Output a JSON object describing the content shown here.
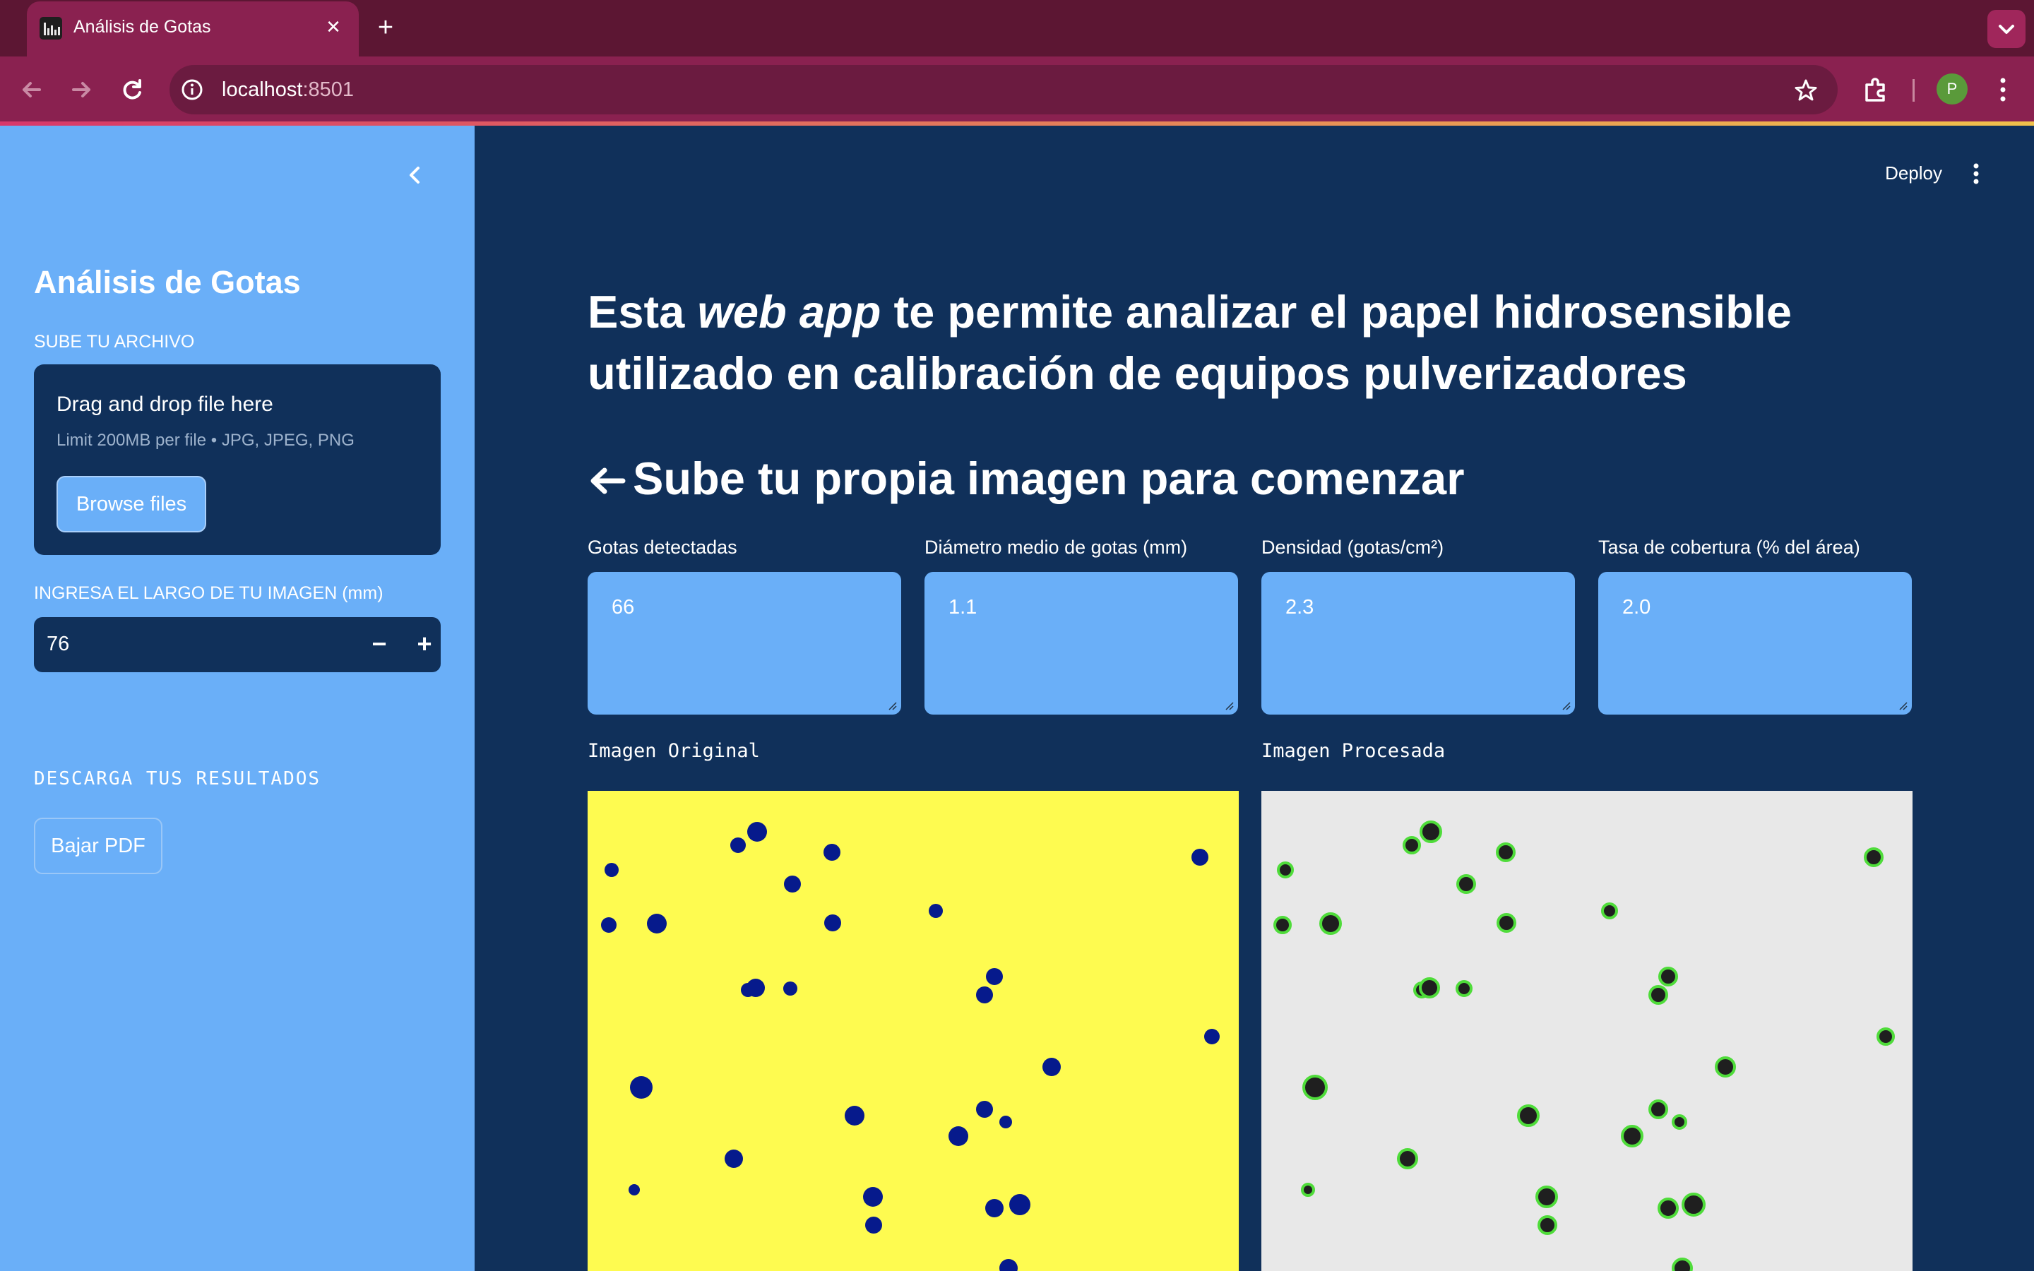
{
  "browser": {
    "tab_title": "Análisis de Gotas",
    "url_host": "localhost",
    "url_port": ":8501",
    "profile_initial": "P"
  },
  "sidebar": {
    "title": "Análisis de Gotas",
    "upload_label": "SUBE TU ARCHIVO",
    "dropzone_title": "Drag and drop file here",
    "dropzone_limit": "Limit 200MB per file • JPG, JPEG, PNG",
    "browse_button": "Browse files",
    "length_label": "INGRESA EL LARGO DE TU IMAGEN (mm)",
    "length_value": "76",
    "minus": "−",
    "plus": "+",
    "download_label": "DESCARGA TUS RESULTADOS",
    "pdf_button": "Bajar PDF"
  },
  "main": {
    "deploy": "Deploy",
    "headline_1": "Esta ",
    "headline_em": "web app",
    "headline_2": " te permite analizar el papel hidrosensible utilizado en calibración de equipos pulverizadores",
    "subhead": "Sube tu propia imagen para comenzar",
    "metrics": [
      {
        "label": "Gotas detectadas",
        "value": "66"
      },
      {
        "label": "Diámetro medio de gotas (mm)",
        "value": "1.1"
      },
      {
        "label": "Densidad (gotas/cm²)",
        "value": "2.3"
      },
      {
        "label": "Tasa de cobertura (% del área)",
        "value": "2.0"
      }
    ],
    "caption_original": "Imagen Original",
    "caption_processed": "Imagen Procesada"
  },
  "colors": {
    "paper_yellow": "#fefb50",
    "drop_blue": "#061a8c",
    "processed_bg": "#e8e8e8",
    "drop_dark": "#1f1f1f",
    "contour_green": "#4fdc3a"
  },
  "icons": [
    "tab-favicon-icon",
    "close-icon",
    "plus-icon",
    "back-icon",
    "forward-icon",
    "reload-icon",
    "info-icon",
    "star-icon",
    "extensions-icon",
    "kebab-menu-icon",
    "chevron-left-icon",
    "arrow-left-icon"
  ]
}
